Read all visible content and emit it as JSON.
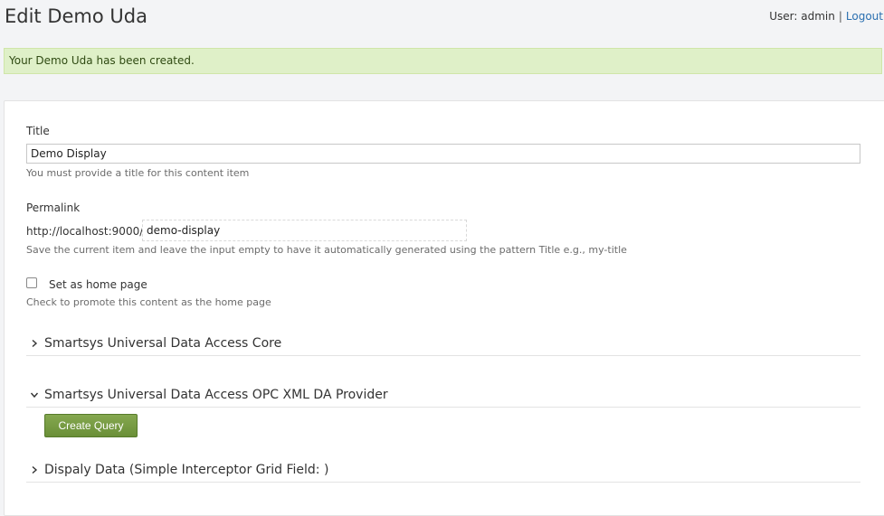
{
  "header": {
    "title": "Edit Demo Uda",
    "user_label": "User: admin",
    "separator": "|",
    "logout_label": "Logout"
  },
  "alert": {
    "message": "Your Demo Uda has been created."
  },
  "form": {
    "title": {
      "label": "Title",
      "value": "Demo Display",
      "hint": "You must provide a title for this content item"
    },
    "permalink": {
      "label": "Permalink",
      "prefix": "http://localhost:9000/",
      "value": "demo-display",
      "hint": "Save the current item and leave the input empty to have it automatically generated using the pattern Title e.g., my-title"
    },
    "home_page": {
      "label": "Set as home page",
      "checked": false,
      "hint": "Check to promote this content as the home page"
    },
    "sections": [
      {
        "title": "Smartsys Universal Data Access Core",
        "expanded": false
      },
      {
        "title": "Smartsys Universal Data Access OPC XML DA Provider",
        "expanded": true
      },
      {
        "title": "Dispaly Data (Simple Interceptor Grid Field: )",
        "expanded": false
      }
    ],
    "create_query_label": "Create Query"
  },
  "colors": {
    "alert_bg": "#dff0c8",
    "button_green": "#6a8f38",
    "link_blue": "#2a6fb0"
  },
  "icons": {
    "collapsed": "chevron-right-icon",
    "expanded": "chevron-down-icon"
  }
}
